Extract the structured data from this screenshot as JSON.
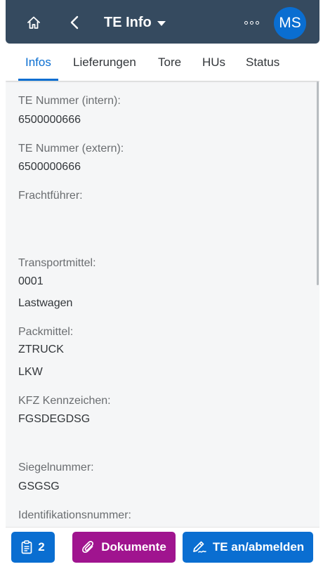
{
  "header": {
    "title": "TE Info",
    "avatar_initials": "MS",
    "icons": [
      "home-icon",
      "back-icon",
      "dropdown-caret-icon",
      "overflow-icon"
    ]
  },
  "tabs": [
    {
      "label": "Infos",
      "active": true
    },
    {
      "label": "Lieferungen",
      "active": false
    },
    {
      "label": "Tore",
      "active": false
    },
    {
      "label": "HUs",
      "active": false
    },
    {
      "label": "Status",
      "active": false
    }
  ],
  "fields": {
    "te_intern": {
      "label": "TE Nummer (intern):",
      "value": "6500000666"
    },
    "te_extern": {
      "label": "TE Nummer (extern):",
      "value": "6500000666"
    },
    "frachtfuehrer": {
      "label": "Frachtführer:",
      "value": ""
    },
    "transportmittel": {
      "label": "Transportmittel:",
      "value": "0001",
      "description": "Lastwagen"
    },
    "packmittel": {
      "label": "Packmittel:",
      "value": "ZTRUCK",
      "description": "LKW"
    },
    "kfz": {
      "label": "KFZ Kennzeichen:",
      "value": "FGSDEGDSG"
    },
    "siegel": {
      "label": "Siegelnummer:",
      "value": "GSGSG"
    },
    "ident": {
      "label": "Identifikationsnummer:",
      "value": ""
    }
  },
  "footer": {
    "count_label": "2",
    "documents_label": "Dokumente",
    "te_label": "TE an/abmelden"
  },
  "colors": {
    "header_bg": "#354a5f",
    "accent": "#0a6ed1",
    "documents_button": "#a0148f",
    "content_bg": "#f5f6f7"
  }
}
